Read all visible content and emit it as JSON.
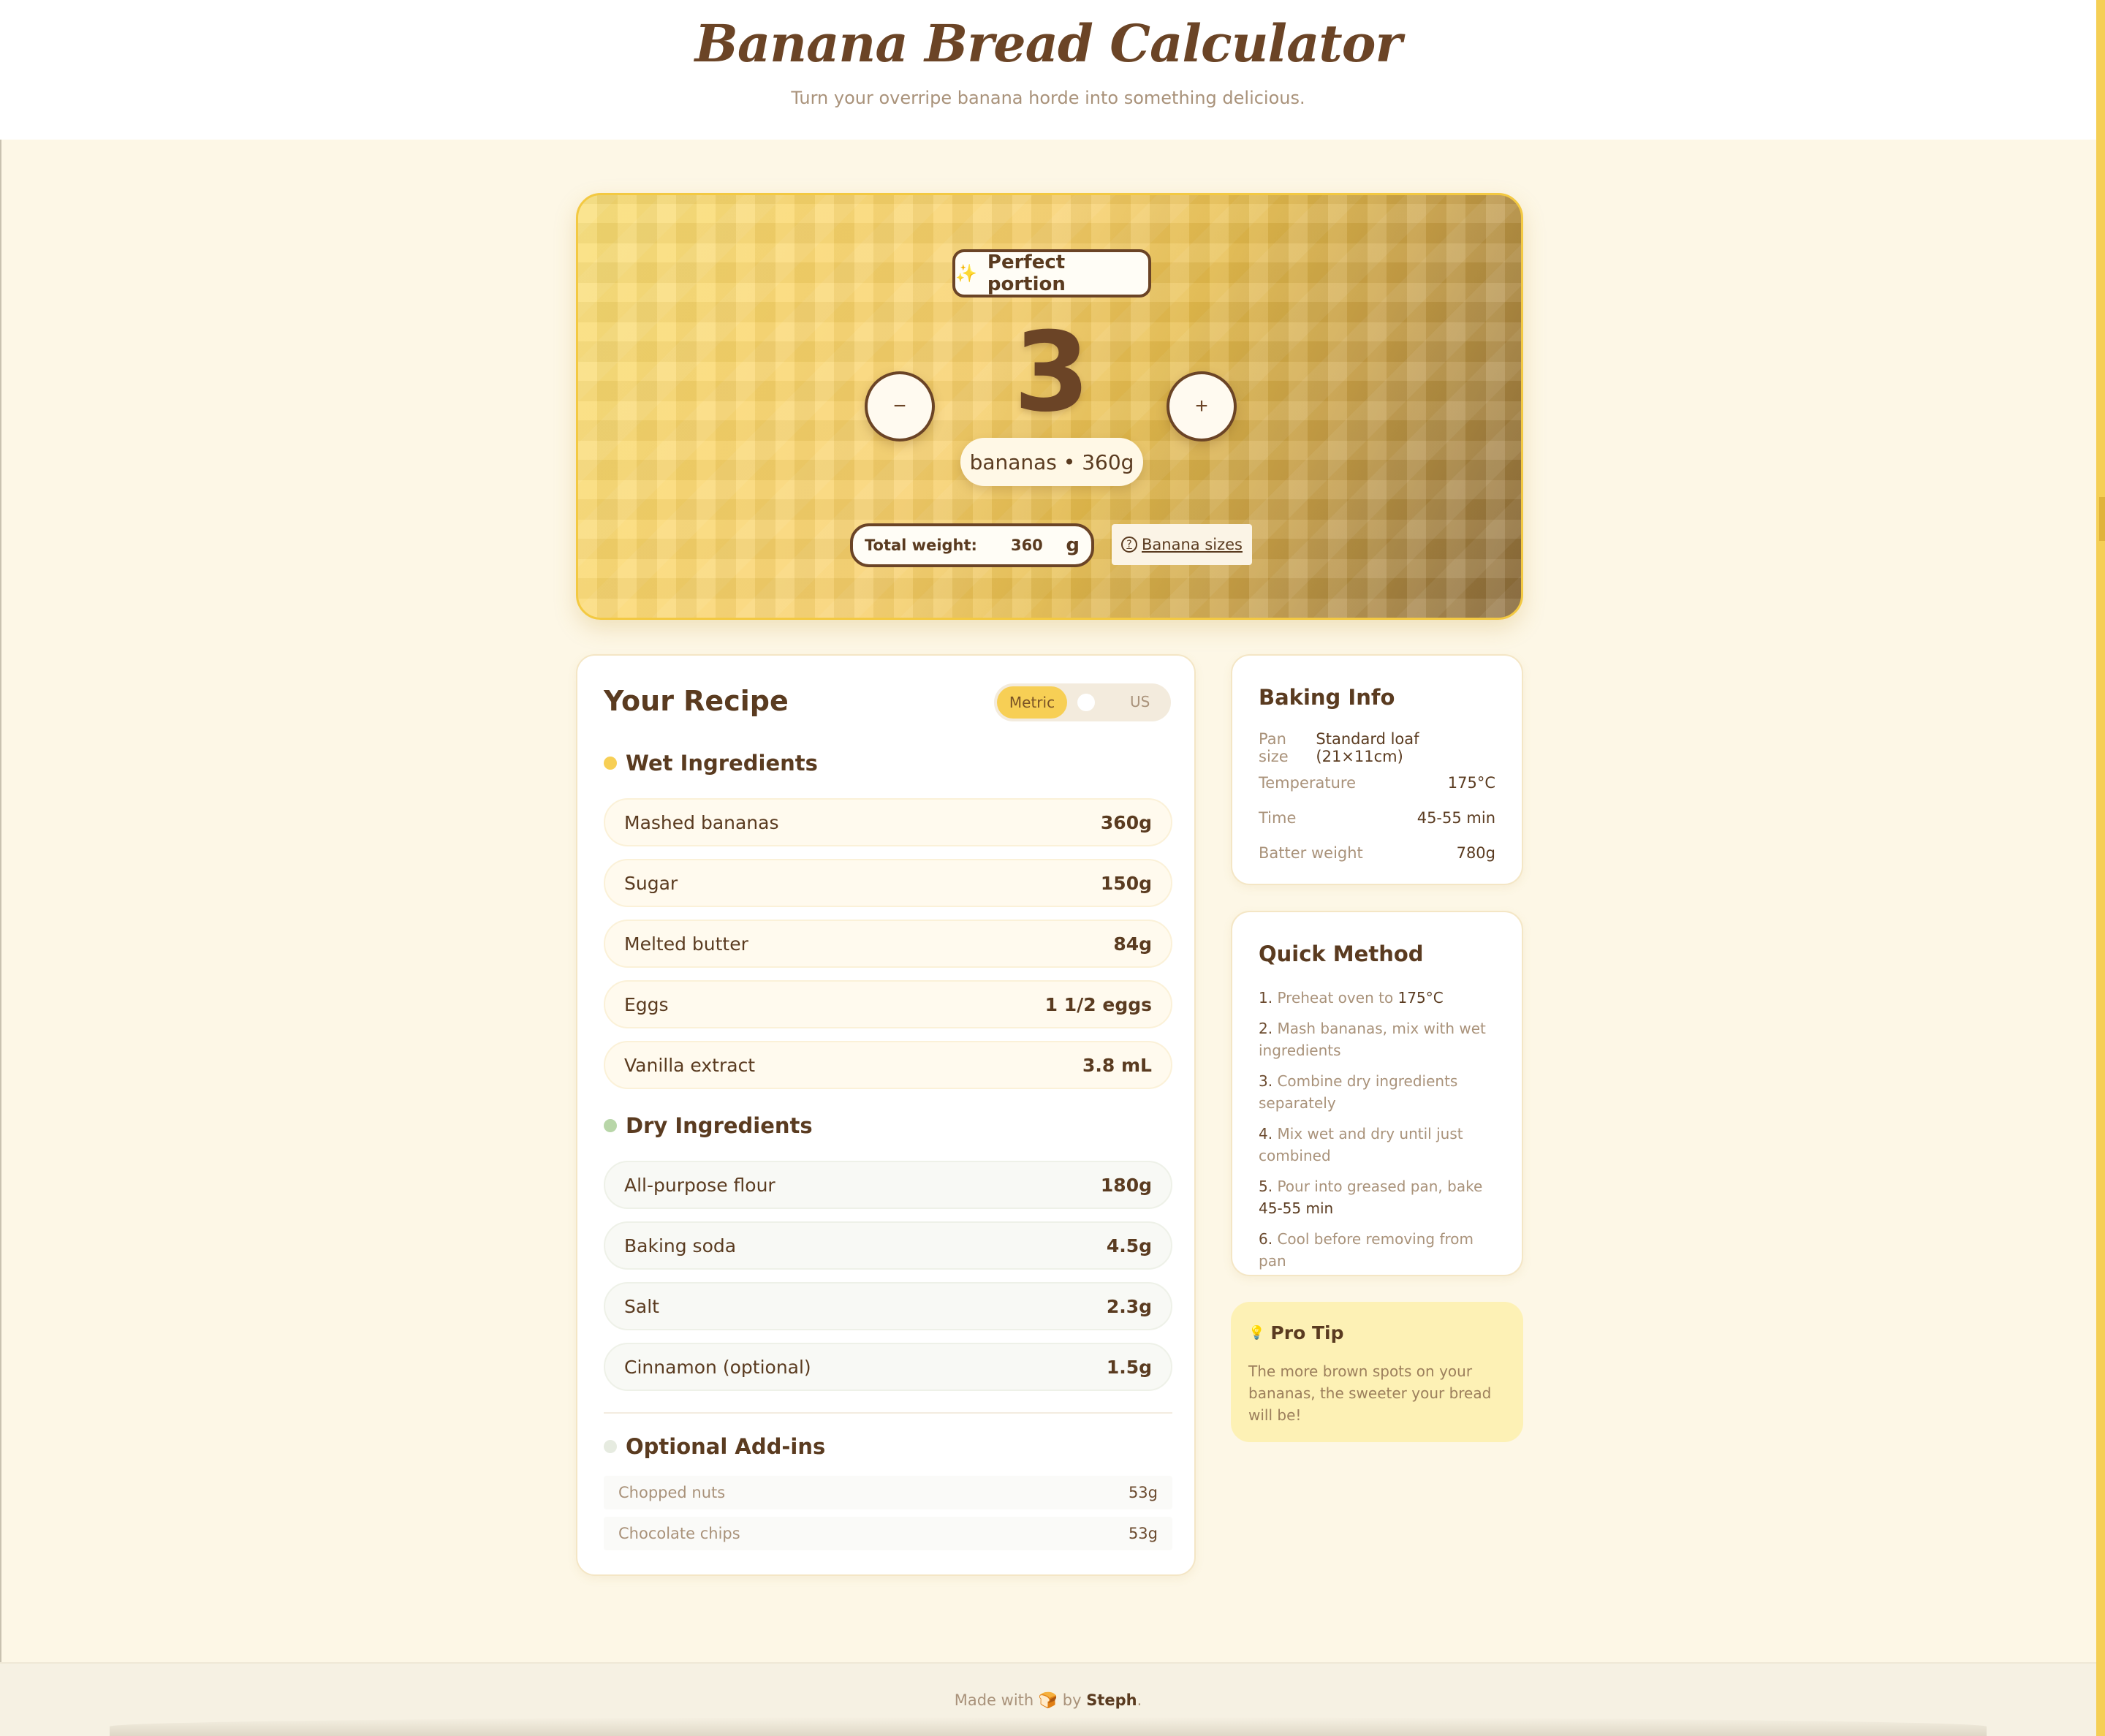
{
  "header": {
    "title": "Banana Bread Calculator",
    "subtitle": "Turn your overripe banana horde into something delicious."
  },
  "hero": {
    "badge_label": "Perfect portion",
    "badge_icon": "sparkle-icon",
    "count": "3",
    "minus_label": "−",
    "plus_label": "+",
    "summary": "bananas • 360g",
    "weight_label": "Total weight:",
    "weight_value": "360",
    "weight_unit": "g",
    "sizes_label": "Banana sizes",
    "sizes_icon_glyph": "?"
  },
  "recipe": {
    "title": "Your Recipe",
    "toggle": {
      "metric_label": "Metric",
      "us_label": "US",
      "selected": "Metric"
    },
    "wet": {
      "title": "Wet Ingredients",
      "items": [
        {
          "name": "Mashed bananas",
          "qty": "360g"
        },
        {
          "name": "Sugar",
          "qty": "150g"
        },
        {
          "name": "Melted butter",
          "qty": "84g"
        },
        {
          "name": "Eggs",
          "qty": "1 1/2 eggs"
        },
        {
          "name": "Vanilla extract",
          "qty": "3.8 mL"
        }
      ]
    },
    "dry": {
      "title": "Dry Ingredients",
      "items": [
        {
          "name": "All-purpose flour",
          "qty": "180g"
        },
        {
          "name": "Baking soda",
          "qty": "4.5g"
        },
        {
          "name": "Salt",
          "qty": "2.3g"
        },
        {
          "name": "Cinnamon (optional)",
          "qty": "1.5g"
        }
      ]
    },
    "addins": {
      "title": "Optional Add-ins",
      "items": [
        {
          "name": "Chopped nuts",
          "qty": "53g"
        },
        {
          "name": "Chocolate chips",
          "qty": "53g"
        }
      ]
    }
  },
  "baking_info": {
    "title": "Baking Info",
    "rows": [
      {
        "key": "Pan size",
        "value": "Standard loaf (21×11cm)"
      },
      {
        "key": "Temperature",
        "value": "175°C"
      },
      {
        "key": "Time",
        "value": "45-55 min"
      },
      {
        "key": "Batter weight",
        "value": "780g"
      }
    ]
  },
  "method": {
    "title": "Quick Method",
    "steps": [
      {
        "num": "1.",
        "text": "Preheat oven to ",
        "em": "175°C",
        "after": ""
      },
      {
        "num": "2.",
        "text": "Mash bananas, mix with wet ingredients",
        "em": "",
        "after": ""
      },
      {
        "num": "3.",
        "text": "Combine dry ingredients separately",
        "em": "",
        "after": ""
      },
      {
        "num": "4.",
        "text": "Mix wet and dry until just combined",
        "em": "",
        "after": ""
      },
      {
        "num": "5.",
        "text": "Pour into greased pan, bake ",
        "em": "45-55 min",
        "after": ""
      },
      {
        "num": "6.",
        "text": "Cool before removing from pan",
        "em": "",
        "after": ""
      }
    ]
  },
  "tip": {
    "title": "Pro Tip",
    "icon": "lightbulb-icon",
    "text": "The more brown spots on your bananas, the sweeter your bread will be!"
  },
  "footer": {
    "prefix": "Made with",
    "icon": "bread-icon",
    "by": "by",
    "author": "Steph",
    "suffix": "."
  },
  "colors": {
    "accent": "#f7cf55",
    "brown": "#6b4426",
    "background": "#fdf7e6",
    "tip_background": "#fdf1b5"
  }
}
